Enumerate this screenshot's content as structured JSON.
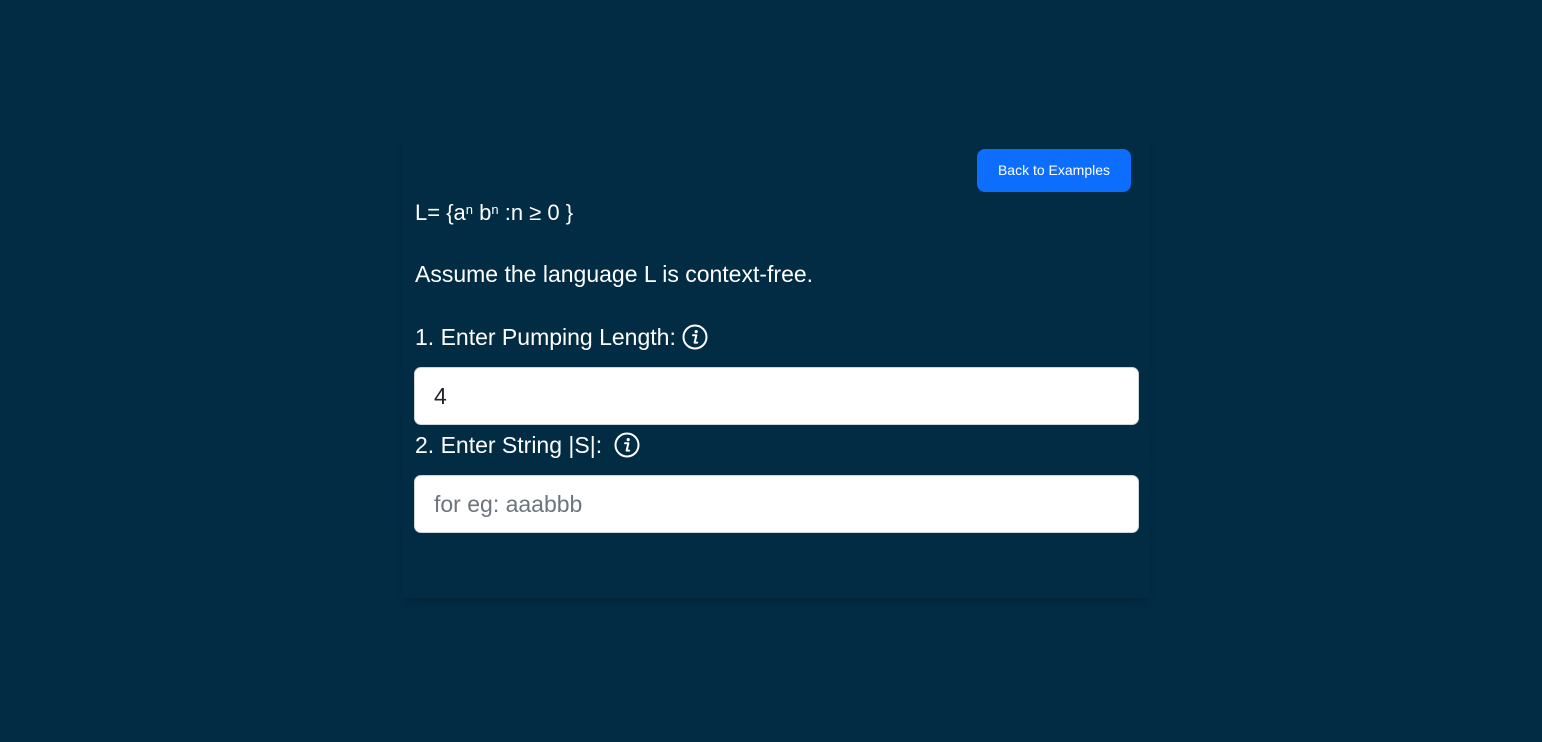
{
  "header": {
    "back_button_label": "Back to Examples"
  },
  "language": {
    "prefix": "L= {a",
    "exp_a": "n",
    "mid": " b",
    "exp_b": "n",
    "suffix": " :n ≥ 0 }"
  },
  "assumption_text": "Assume the language L is context-free.",
  "form": {
    "pumping_length": {
      "label": "1. Enter Pumping Length:",
      "value": "4",
      "info_icon": "info-circle-icon"
    },
    "string": {
      "label": "2. Enter String |S|:",
      "value": "",
      "placeholder": "for eg: aaabbb",
      "info_icon": "info-circle-icon"
    }
  },
  "colors": {
    "background": "#012c44",
    "accent": "#0d6efd",
    "text": "#ffffff"
  }
}
